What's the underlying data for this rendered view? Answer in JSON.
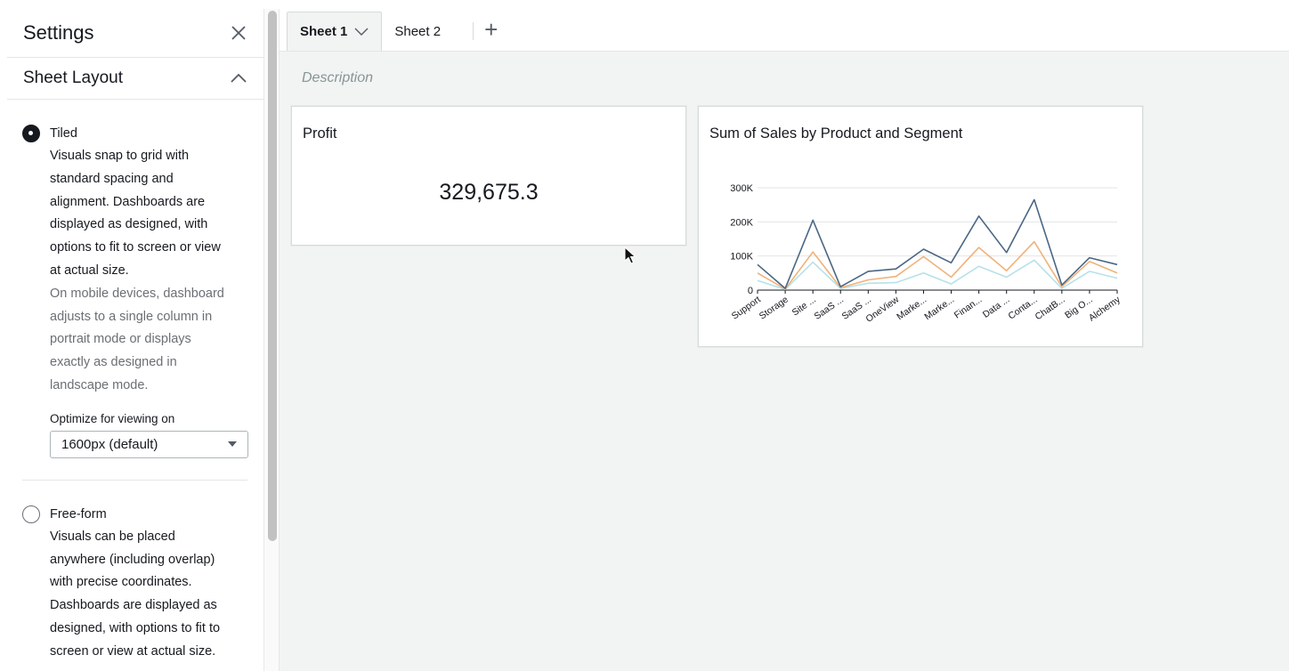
{
  "settings": {
    "title": "Settings",
    "section_title": "Sheet Layout",
    "tiled": {
      "label": "Tiled",
      "selected": true,
      "description_lines": [
        "Visuals snap to grid with",
        "standard spacing and",
        "alignment. Dashboards are",
        "displayed as designed, with",
        "options to fit to screen or view",
        "at actual size."
      ],
      "mobile_lines": [
        "On mobile devices, dashboard",
        "adjusts to a single column in",
        "portrait mode or displays",
        "exactly as designed in",
        "landscape mode."
      ],
      "optimize_label": "Optimize for viewing on",
      "optimize_value": "1600px (default)"
    },
    "freeform": {
      "label": "Free-form",
      "selected": false,
      "description_lines": [
        "Visuals can be placed",
        "anywhere (including overlap)",
        "with precise coordinates.",
        "Dashboards are displayed as",
        "designed, with options to fit to",
        "screen or view at actual size."
      ]
    }
  },
  "tabs": [
    {
      "label": "Sheet 1",
      "active": true
    },
    {
      "label": "Sheet 2",
      "active": false
    }
  ],
  "add_tab_label": "+",
  "description_placeholder": "Description",
  "kpi": {
    "title": "Profit",
    "value": "329,675.3"
  },
  "chart_data": {
    "type": "line",
    "title": "Sum of Sales by Product and Segment",
    "xlabel": "",
    "ylabel": "",
    "categories": [
      "Support",
      "Storage",
      "Site ...",
      "SaaS ...",
      "SaaS ...",
      "OneView",
      "Marke...",
      "Marke...",
      "Finan...",
      "Data ...",
      "Conta...",
      "ChatB...",
      "Big O...",
      "Alchemy"
    ],
    "y_ticks": [
      "0",
      "100K",
      "200K",
      "300K"
    ],
    "ylim": [
      0,
      300000
    ],
    "grid": true,
    "series": [
      {
        "color": "#4a6784",
        "values": [
          75000,
          5000,
          205000,
          10000,
          55000,
          62000,
          120000,
          80000,
          217000,
          110000,
          265000,
          15000,
          95000,
          75000
        ]
      },
      {
        "color": "#f0b27a",
        "values": [
          50000,
          3000,
          112000,
          7000,
          30000,
          40000,
          98000,
          38000,
          125000,
          57000,
          142000,
          10000,
          84000,
          50000
        ]
      },
      {
        "color": "#b7e1ea",
        "values": [
          28000,
          2000,
          82000,
          5000,
          20000,
          22000,
          50000,
          18000,
          70000,
          38000,
          88000,
          5000,
          55000,
          35000
        ]
      }
    ]
  }
}
